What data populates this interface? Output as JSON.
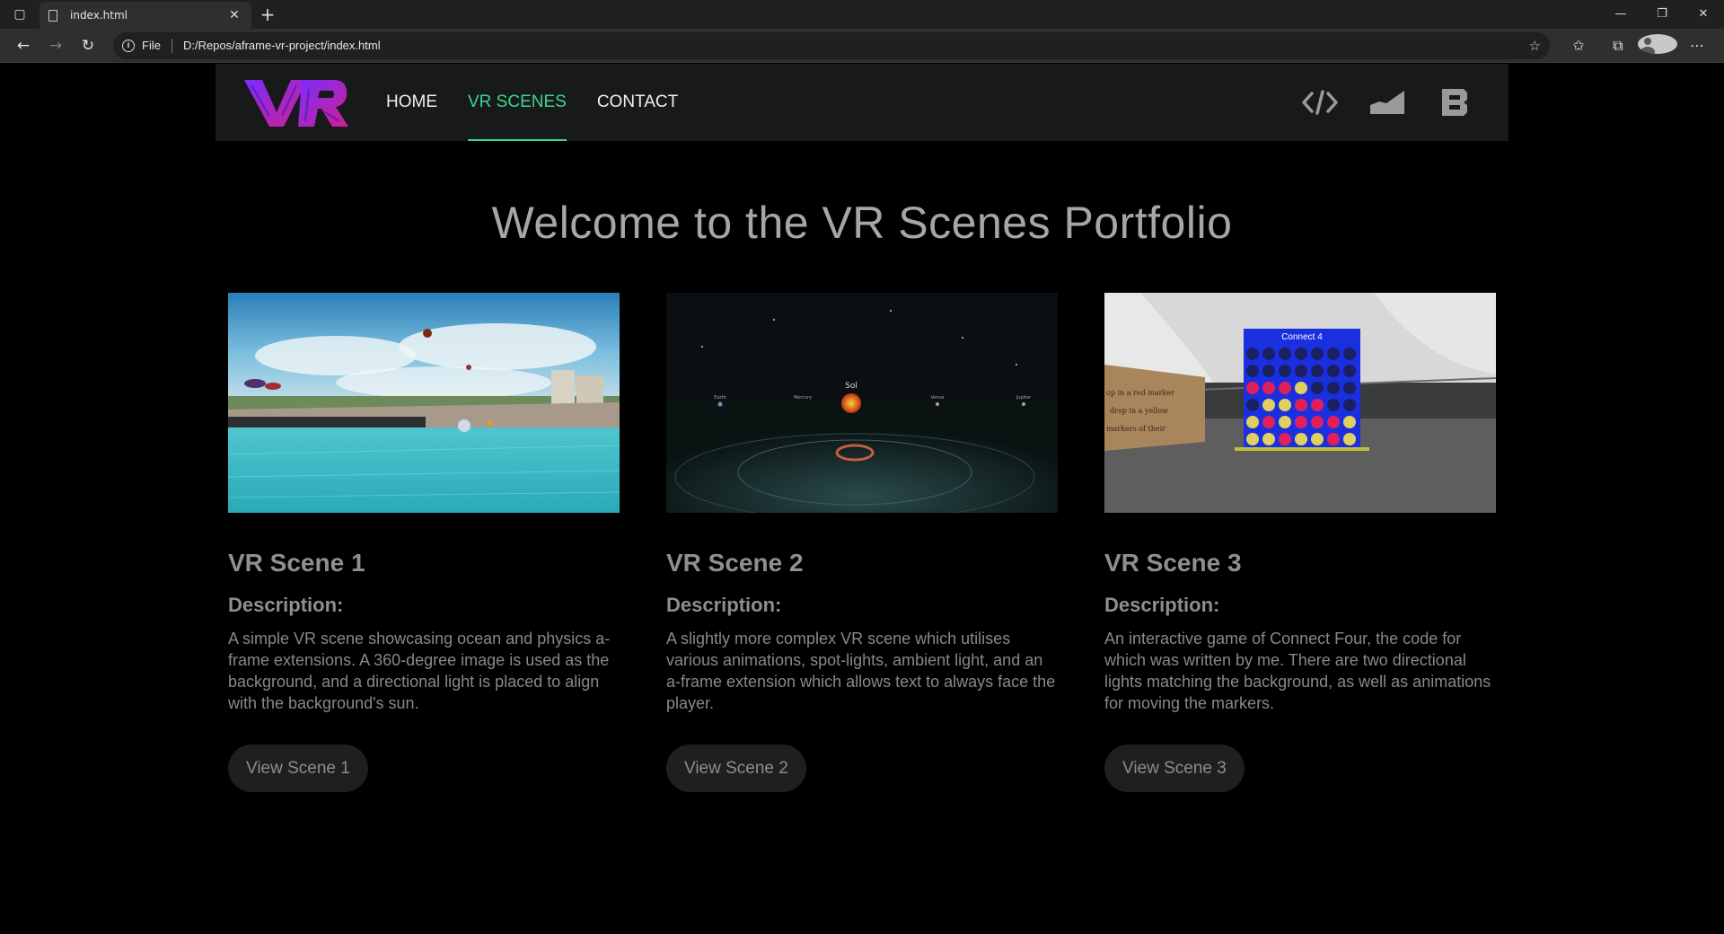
{
  "browser": {
    "tab_title": "index.html",
    "new_tab": "+",
    "address_scheme": "File",
    "address_url": "D:/Repos/aframe-vr-project/index.html",
    "window_controls": [
      "—",
      "❐",
      "✕"
    ]
  },
  "site": {
    "logo_text": "VR",
    "nav": [
      {
        "label": "HOME",
        "active": false
      },
      {
        "label": "VR SCENES",
        "active": true
      },
      {
        "label": "CONTACT",
        "active": false
      }
    ],
    "social_icons": [
      "code-icon",
      "chart-icon",
      "b3-icon"
    ],
    "accent_color": "#3dd68c"
  },
  "main": {
    "heading": "Welcome to the VR Scenes Portfolio",
    "cards": [
      {
        "title": "VR Scene 1",
        "desc_label": "Description:",
        "desc": "A simple VR scene showcasing ocean and physics a-frame extensions. A 360-degree image is used as the background, and a directional light is placed to align with the background's sun.",
        "button": "View Scene 1"
      },
      {
        "title": "VR Scene 2",
        "desc_label": "Description:",
        "desc": "A slightly more complex VR scene which utilises various animations, spot-lights, ambient light, and an a-frame extension which allows text to always face the player.",
        "button": "View Scene 2",
        "thumb_labels": {
          "sun": "Sol",
          "p1": "Earth",
          "p2": "Mercury",
          "p3": "Venus",
          "p4": "Jupiter"
        }
      },
      {
        "title": "VR Scene 3",
        "desc_label": "Description:",
        "desc": "An interactive game of Connect Four, the code for which was written by me. There are two directional lights matching the background, as well as animations for moving the markers.",
        "button": "View Scene 3",
        "thumb_labels": {
          "board": "Connect 4",
          "sign1": "op in a red marker",
          "sign2": "drop in a yellow",
          "sign3": "markers of their"
        }
      }
    ]
  }
}
